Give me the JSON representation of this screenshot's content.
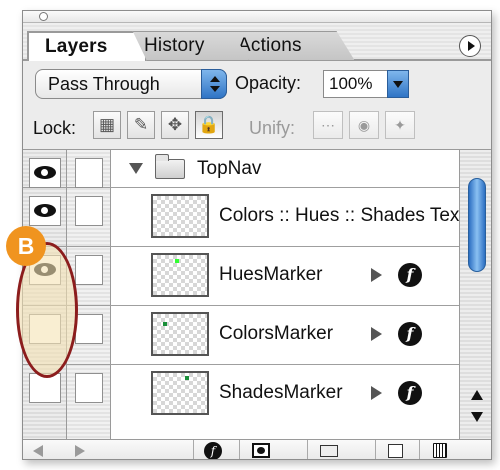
{
  "tabs": [
    {
      "label": "Layers"
    },
    {
      "label": "History"
    },
    {
      "label": "Actions"
    }
  ],
  "blend_mode": {
    "value": "Pass Through"
  },
  "opacity": {
    "label": "Opacity:",
    "value": "100%"
  },
  "lock": {
    "label": "Lock:"
  },
  "unify": {
    "label": "Unify:"
  },
  "layers": [
    {
      "name": "TopNav"
    },
    {
      "name": "Colors :: Hues :: Shades Text"
    },
    {
      "name": "HuesMarker"
    },
    {
      "name": "ColorsMarker"
    },
    {
      "name": "ShadesMarker"
    }
  ],
  "effects_icon_text": "f",
  "callout": {
    "label": "B"
  },
  "accent_color": "#2f74c5",
  "callout_color": "#f0941f",
  "highlight_color": "#8c1d1d"
}
